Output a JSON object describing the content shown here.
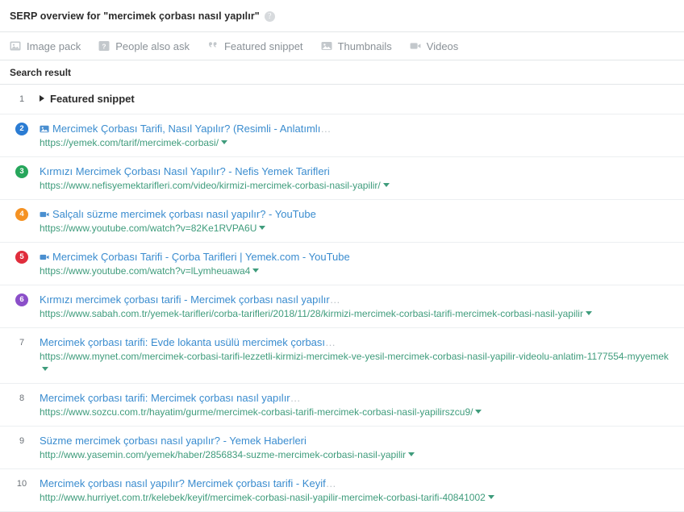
{
  "header": {
    "title": "SERP overview for \"mercimek çorbası nasıl yapılır\"",
    "help_icon": "help-circle-icon"
  },
  "feature_bar": {
    "items": [
      {
        "label": "Image pack",
        "icon": "image-pack-icon"
      },
      {
        "label": "People also ask",
        "icon": "people-also-ask-icon"
      },
      {
        "label": "Featured snippet",
        "icon": "quote-icon"
      },
      {
        "label": "Thumbnails",
        "icon": "thumbnail-icon"
      },
      {
        "label": "Videos",
        "icon": "video-camera-icon"
      }
    ]
  },
  "results_table": {
    "column_header": "Search result",
    "rows": [
      {
        "rank": "1",
        "badge": false,
        "featured_snippet": true,
        "label": "Featured snippet"
      },
      {
        "rank": "2",
        "badge": true,
        "badge_color": "#2b7cd3",
        "type_icon": "thumbnail-icon",
        "title": "Mercimek Çorbası Tarifi, Nasıl Yapılır? (Resimli - Anlatımlı",
        "title_ellipsis": "…",
        "url": "https://yemek.com/tarif/mercimek-corbasi/"
      },
      {
        "rank": "3",
        "badge": true,
        "badge_color": "#26a65b",
        "type_icon": "none",
        "title": "Kırmızı Mercimek Çorbası Nasıl Yapılır? - Nefis Yemek Tarifleri",
        "title_ellipsis": "",
        "url": "https://www.nefisyemektarifleri.com/video/kirmizi-mercimek-corbasi-nasil-yapilir/"
      },
      {
        "rank": "4",
        "badge": true,
        "badge_color": "#f59223",
        "type_icon": "video-camera-icon",
        "title": "Salçalı süzme mercimek çorbası nasıl yapılır? - YouTube",
        "title_ellipsis": "",
        "url": "https://www.youtube.com/watch?v=82Ke1RVPA6U"
      },
      {
        "rank": "5",
        "badge": true,
        "badge_color": "#e02d3c",
        "type_icon": "video-camera-icon",
        "title": "Mercimek Çorbası Tarifi - Çorba Tarifleri | Yemek.com - YouTube",
        "title_ellipsis": "",
        "url": "https://www.youtube.com/watch?v=lLymheuawa4"
      },
      {
        "rank": "6",
        "badge": true,
        "badge_color": "#8b4fc9",
        "type_icon": "none",
        "title": "Kırmızı mercimek çorbası tarifi - Mercimek çorbası nasıl yapılır",
        "title_ellipsis": "…",
        "url": "https://www.sabah.com.tr/yemek-tarifleri/corba-tarifleri/2018/11/28/kirmizi-mercimek-corbasi-tarifi-mercimek-corbasi-nasil-yapilir"
      },
      {
        "rank": "7",
        "badge": false,
        "type_icon": "none",
        "title": "Mercimek çorbası tarifi: Evde lokanta usülü mercimek çorbası",
        "title_ellipsis": "…",
        "url": "https://www.mynet.com/mercimek-corbasi-tarifi-lezzetli-kirmizi-mercimek-ve-yesil-mercimek-corbasi-nasil-yapilir-videolu-anlatim-1177554-myyemek"
      },
      {
        "rank": "8",
        "badge": false,
        "type_icon": "none",
        "title": "Mercimek çorbası tarifi: Mercimek çorbası nasıl yapılır",
        "title_ellipsis": "…",
        "url": "https://www.sozcu.com.tr/hayatim/gurme/mercimek-corbasi-tarifi-mercimek-corbasi-nasil-yapilirszcu9/"
      },
      {
        "rank": "9",
        "badge": false,
        "type_icon": "none",
        "title": "Süzme mercimek çorbası nasıl yapılır? - Yemek Haberleri",
        "title_ellipsis": "",
        "url": "http://www.yasemin.com/yemek/haber/2856834-suzme-mercimek-corbasi-nasil-yapilir"
      },
      {
        "rank": "10",
        "badge": false,
        "type_icon": "none",
        "title": "Mercimek çorbası nasıl yapılır? Mercimek çorbası tarifi - Keyif",
        "title_ellipsis": "…",
        "url": "http://www.hurriyet.com.tr/kelebek/keyif/mercimek-corbasi-nasil-yapilir-mercimek-corbasi-tarifi-40841002"
      }
    ]
  },
  "colors": {
    "title_link": "#3a8ccf",
    "url_text": "#3f9c7c",
    "muted_label": "#8a9197",
    "border": "#e3e6e8"
  }
}
